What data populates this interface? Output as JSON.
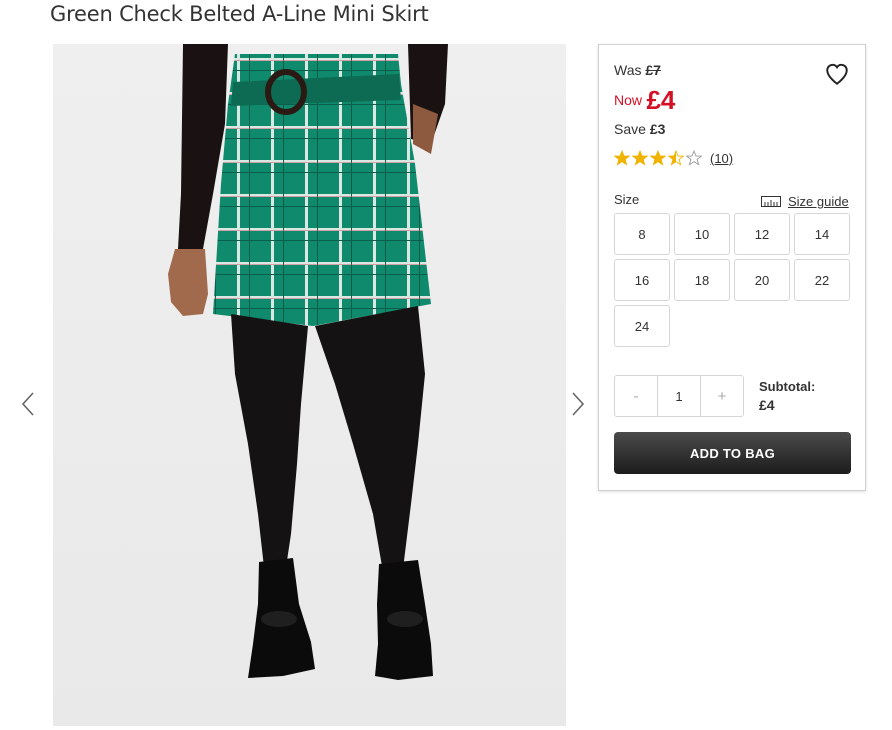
{
  "product": {
    "title": "Green Check Belted A-Line Mini Skirt",
    "image_alt": "Model wearing green check belted mini skirt with black tights and boots"
  },
  "gallery": {
    "prev_icon": "chevron-left-icon",
    "next_icon": "chevron-right-icon"
  },
  "pricing": {
    "was_label": "Was",
    "was_price": "£7",
    "now_label": "Now",
    "now_price": "£4",
    "save_label": "Save",
    "save_amount": "£3",
    "sale_color": "#d50f25"
  },
  "wishlist": {
    "icon": "heart-icon"
  },
  "rating": {
    "stars": 3.5,
    "max": 5,
    "count": "(10)",
    "star_color": "#f0b400"
  },
  "sizes": {
    "label": "Size",
    "guide_label": "Size guide",
    "guide_icon": "ruler-icon",
    "options": [
      {
        "label": "8"
      },
      {
        "label": "10"
      },
      {
        "label": "12"
      },
      {
        "label": "14"
      },
      {
        "label": "16"
      },
      {
        "label": "18"
      },
      {
        "label": "20"
      },
      {
        "label": "22"
      },
      {
        "label": "24"
      }
    ]
  },
  "quantity": {
    "minus": "-",
    "value": "1",
    "plus": "+"
  },
  "subtotal": {
    "label": "Subtotal:",
    "value": "£4"
  },
  "cta": {
    "add_to_bag": "ADD TO BAG"
  }
}
